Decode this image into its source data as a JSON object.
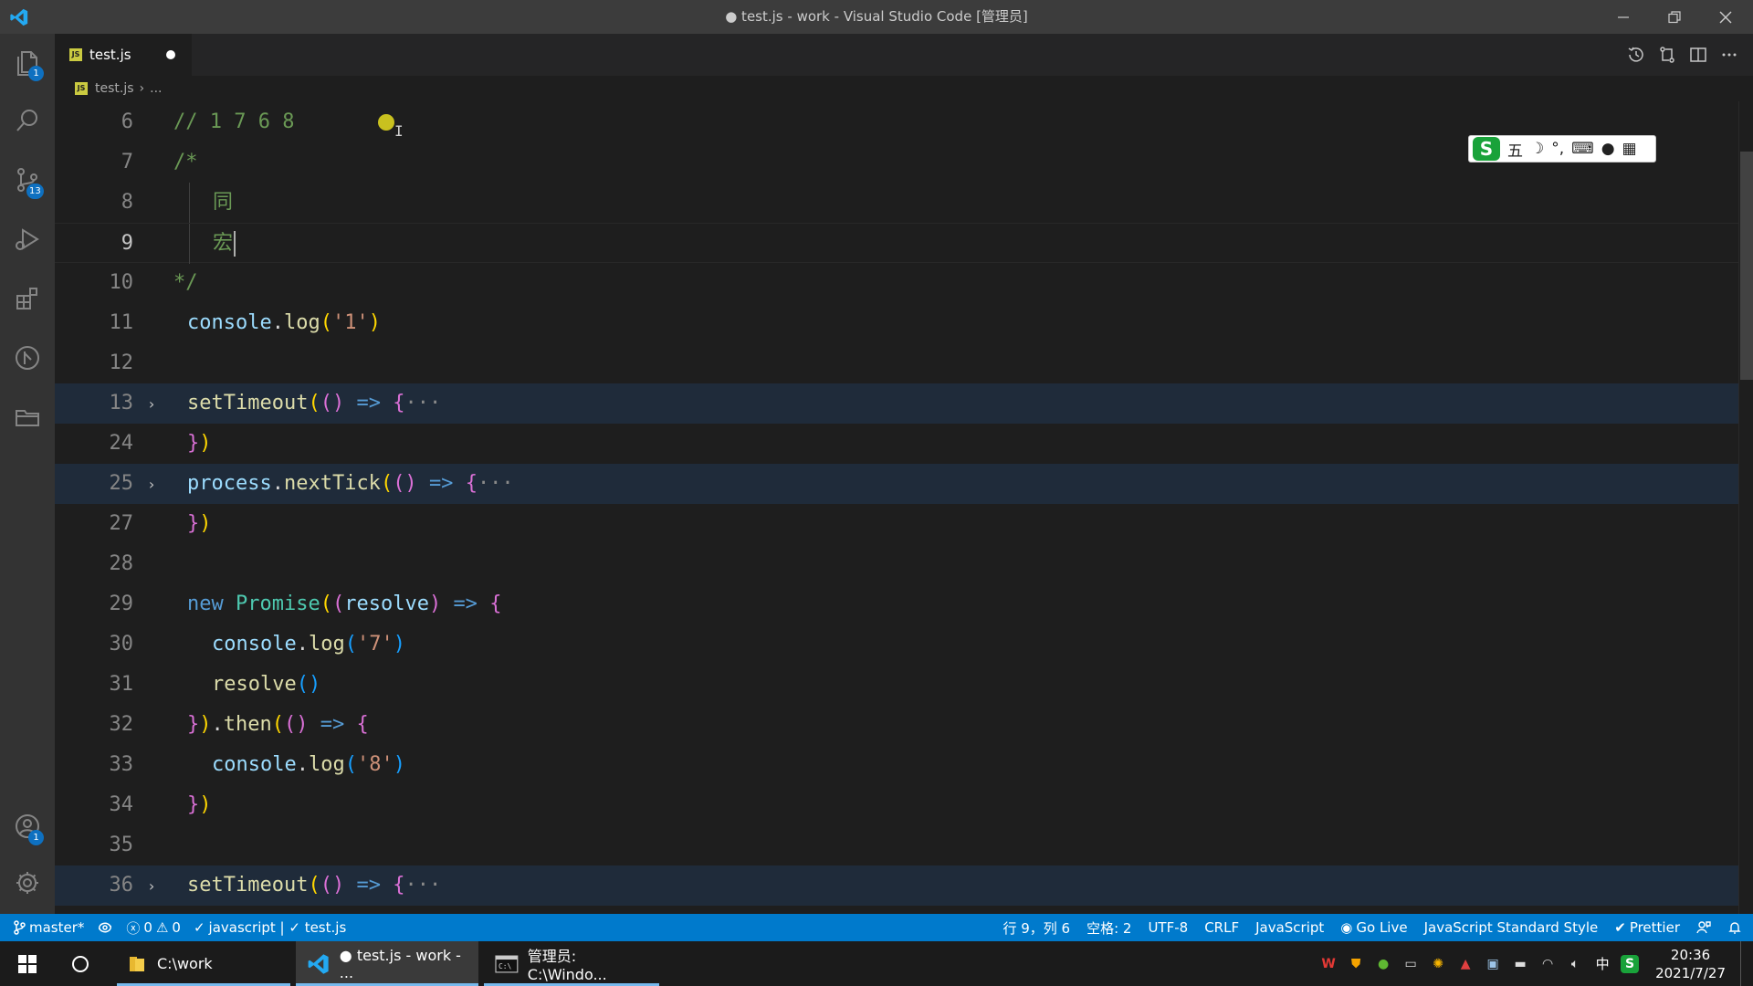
{
  "window": {
    "title": "● test.js - work - Visual Studio Code [管理员]"
  },
  "activity_bar": {
    "explorer_badge": "1",
    "scm_badge": "13",
    "accounts_badge": "1"
  },
  "tabs": [
    {
      "label": "test.js",
      "dirty": true
    }
  ],
  "breadcrumb": {
    "file": "test.js",
    "rest": "..."
  },
  "editor": {
    "lines": [
      {
        "n": "6"
      },
      {
        "n": "7"
      },
      {
        "n": "8"
      },
      {
        "n": "9"
      },
      {
        "n": "10"
      },
      {
        "n": "11"
      },
      {
        "n": "12"
      },
      {
        "n": "13"
      },
      {
        "n": "24"
      },
      {
        "n": "25"
      },
      {
        "n": "27"
      },
      {
        "n": "28"
      },
      {
        "n": "29"
      },
      {
        "n": "30"
      },
      {
        "n": "31"
      },
      {
        "n": "32"
      },
      {
        "n": "33"
      },
      {
        "n": "34"
      },
      {
        "n": "35"
      },
      {
        "n": "36"
      }
    ],
    "text": {
      "l6": "// 1 7 6 8",
      "l7": "/*",
      "l8": "同",
      "l9": "宏",
      "l10": "*/",
      "console": "console",
      "log": "log",
      "s1": "'1'",
      "setTimeout": "setTimeout",
      "process": "process",
      "nextTick": "nextTick",
      "new": "new",
      "Promise": "Promise",
      "resolve": "resolve",
      "s7": "'7'",
      "then": "then",
      "s8": "'8'",
      "ellipsis": "···",
      "arrow": "=>"
    }
  },
  "ime": {
    "mode": "五",
    "logo": "S"
  },
  "statusbar": {
    "branch": "master*",
    "errors": "0",
    "warnings": "0",
    "lint": "javascript | ✓ test.js",
    "position": "行 9，列 6",
    "spaces": "空格: 2",
    "encoding": "UTF-8",
    "eol": "CRLF",
    "language": "JavaScript",
    "golive": "Go Live",
    "style": "JavaScript Standard Style",
    "prettier": "Prettier"
  },
  "taskbar": {
    "apps": [
      {
        "label": "C:\\work"
      },
      {
        "label": "● test.js - work - ..."
      },
      {
        "label": "管理员: C:\\Windo..."
      }
    ],
    "ime_indicator": "中",
    "time": "20:36",
    "date": "2021/7/27"
  },
  "colors": {
    "accent": "#007acc",
    "titlebar": "#3c3c3c",
    "editor_bg": "#1e1e1e"
  }
}
